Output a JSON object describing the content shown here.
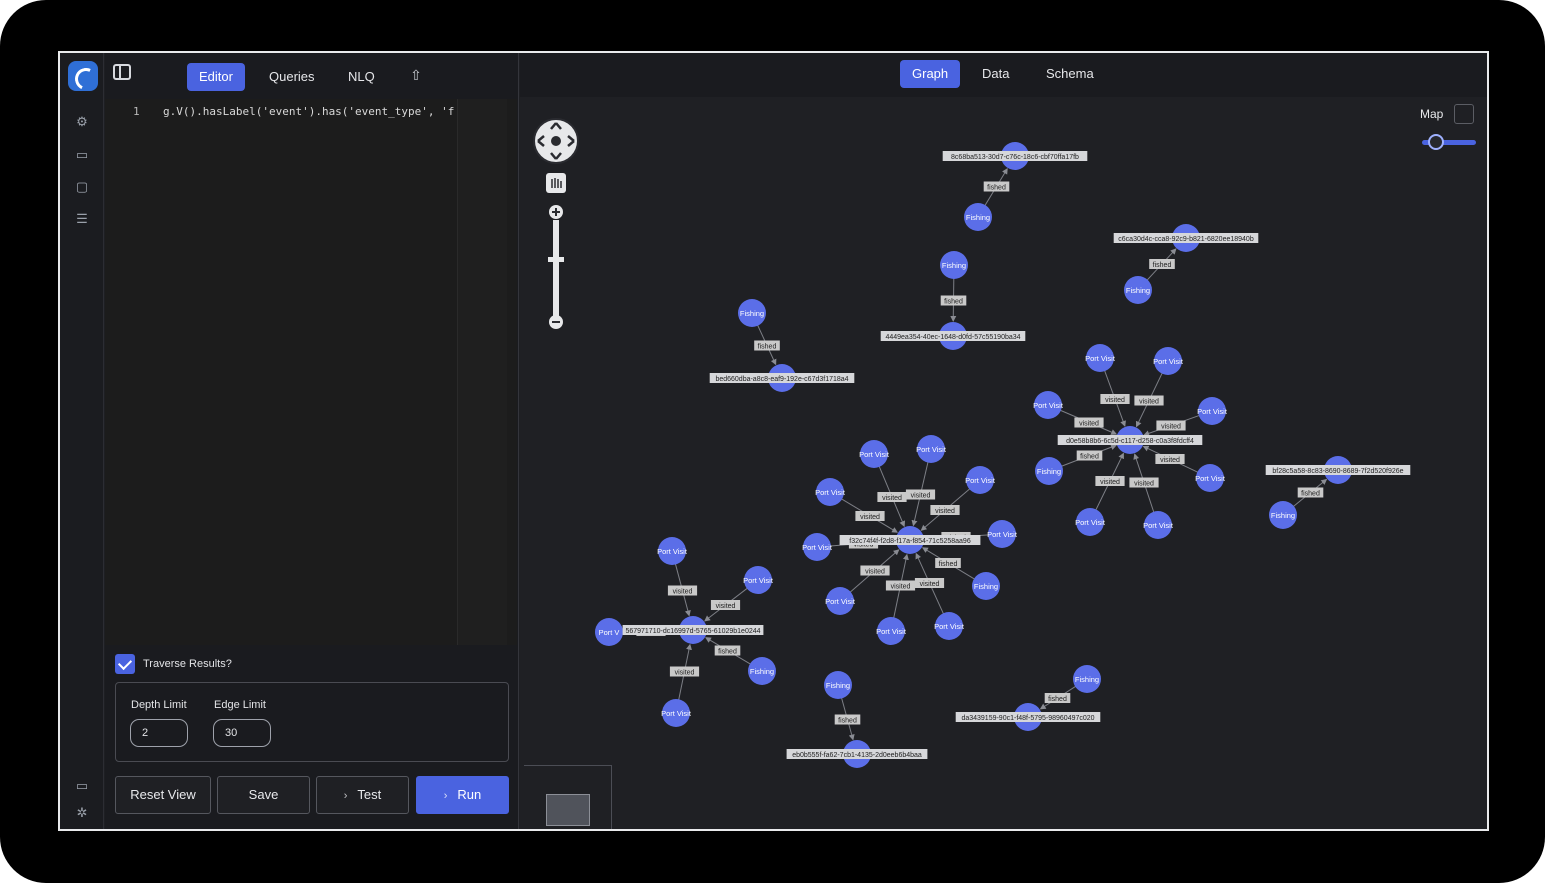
{
  "editor_tabs": {
    "editor": "Editor",
    "queries": "Queries",
    "nlq": "NLQ"
  },
  "code": {
    "line_number": "1",
    "text": "g.V().hasLabel('event').has('event_type', 'fi"
  },
  "traverse": {
    "label": "Traverse Results?",
    "checked": true
  },
  "limits": {
    "depth_label": "Depth Limit",
    "depth_value": "2",
    "edge_label": "Edge Limit",
    "edge_value": "30"
  },
  "actions": {
    "reset": "Reset View",
    "save": "Save",
    "test": "Test",
    "run": "Run"
  },
  "graph_tabs": {
    "graph": "Graph",
    "data": "Data",
    "schema": "Schema"
  },
  "map": {
    "label": "Map"
  },
  "colors": {
    "accent": "#4a63e0",
    "node": "#5b6ee8",
    "edge_label_bg": "#c9c9c9"
  },
  "graph": {
    "nodes": [
      {
        "id": "v8c6",
        "label": "8c68ba513-30d7-c76c-18c6-cbf70ffa17fb"
      },
      {
        "id": "f1",
        "label": "Fishing"
      },
      {
        "id": "c6ca",
        "label": "c6ca30d4c-cca8-92c9-b821-6820ee18940b"
      },
      {
        "id": "f2",
        "label": "Fishing"
      },
      {
        "id": "f3",
        "label": "Fishing"
      },
      {
        "id": "v444",
        "label": "4449ea354-40ec-1648-d0fd-57c55190ba34"
      },
      {
        "id": "f4",
        "label": "Fishing"
      },
      {
        "id": "vbed",
        "label": "bed660dba-a8c8-eaf9-192e-c67d3f1718a4"
      },
      {
        "id": "vd0e",
        "label": "d0e58b8b6-6c5d-c117-d258-c0a3f8fdcff4"
      },
      {
        "id": "p1",
        "label": "Port Visit"
      },
      {
        "id": "p2",
        "label": "Port Visit"
      },
      {
        "id": "p3",
        "label": "Port Visit"
      },
      {
        "id": "p4",
        "label": "Port Visit"
      },
      {
        "id": "f5",
        "label": "Fishing"
      },
      {
        "id": "p5",
        "label": "Port Visit"
      },
      {
        "id": "p6",
        "label": "Port Visit"
      },
      {
        "id": "p7",
        "label": "Port Visit"
      },
      {
        "id": "vbf2",
        "label": "bf28c5a58-8c83-8690-8689-7f2d520f926e"
      },
      {
        "id": "f6",
        "label": "Fishing"
      },
      {
        "id": "vf32",
        "label": "f32c74f4f-f2d8-f17a-f854-71c5258aa96"
      },
      {
        "id": "p8",
        "label": "Port Visit"
      },
      {
        "id": "p9",
        "label": "Port Visit"
      },
      {
        "id": "p10",
        "label": "Port Visit"
      },
      {
        "id": "p11",
        "label": "Port Visit"
      },
      {
        "id": "p12",
        "label": "Port Visit"
      },
      {
        "id": "p13",
        "label": "Port Visit"
      },
      {
        "id": "f7",
        "label": "Fishing"
      },
      {
        "id": "p14",
        "label": "Port Visit"
      },
      {
        "id": "p15",
        "label": "Port Visit"
      },
      {
        "id": "p16",
        "label": "Port Visit"
      },
      {
        "id": "v567",
        "label": "567971710-dc16997d-5765-61029b1e0244"
      },
      {
        "id": "p17",
        "label": "Port Visit"
      },
      {
        "id": "p18",
        "label": "Port Visit"
      },
      {
        "id": "pv",
        "label": "Port V"
      },
      {
        "id": "f8",
        "label": "Fishing"
      },
      {
        "id": "p19",
        "label": "Port Visit"
      },
      {
        "id": "f9",
        "label": "Fishing"
      },
      {
        "id": "veb0",
        "label": "eb0b555f-fa62-7cb1-4135-2d0eeb6b4baa"
      },
      {
        "id": "f10",
        "label": "Fishing"
      },
      {
        "id": "vda3",
        "label": "da3439159-90c1-f48f-5795-98960497c020"
      }
    ],
    "edges": [
      {
        "from": "f1",
        "to": "v8c6",
        "label": "fished"
      },
      {
        "from": "f2",
        "to": "c6ca",
        "label": "fished"
      },
      {
        "from": "f3",
        "to": "v444",
        "label": "fished"
      },
      {
        "from": "f4",
        "to": "vbed",
        "label": "fished"
      },
      {
        "from": "p1",
        "to": "vd0e",
        "label": "visited"
      },
      {
        "from": "p2",
        "to": "vd0e",
        "label": "visited"
      },
      {
        "from": "p3",
        "to": "vd0e",
        "label": "visited"
      },
      {
        "from": "p4",
        "to": "vd0e",
        "label": "visited"
      },
      {
        "from": "f5",
        "to": "vd0e",
        "label": "fished"
      },
      {
        "from": "p5",
        "to": "vd0e",
        "label": "visited"
      },
      {
        "from": "p6",
        "to": "vd0e",
        "label": "visited"
      },
      {
        "from": "p7",
        "to": "vd0e",
        "label": "visited"
      },
      {
        "from": "f6",
        "to": "vbf2",
        "label": "fished"
      },
      {
        "from": "p8",
        "to": "vf32",
        "label": "visited"
      },
      {
        "from": "p9",
        "to": "vf32",
        "label": "visited"
      },
      {
        "from": "p10",
        "to": "vf32",
        "label": "visited"
      },
      {
        "from": "p11",
        "to": "vf32",
        "label": "visited"
      },
      {
        "from": "p12",
        "to": "vf32",
        "label": "visited"
      },
      {
        "from": "p13",
        "to": "vf32",
        "label": "visited"
      },
      {
        "from": "f7",
        "to": "vf32",
        "label": "fished"
      },
      {
        "from": "p14",
        "to": "vf32",
        "label": "visited"
      },
      {
        "from": "p15",
        "to": "vf32",
        "label": "visited"
      },
      {
        "from": "p16",
        "to": "vf32",
        "label": "visited"
      },
      {
        "from": "p17",
        "to": "v567",
        "label": "visited"
      },
      {
        "from": "p18",
        "to": "v567",
        "label": "visited"
      },
      {
        "from": "pv",
        "to": "v567",
        "label": "visited"
      },
      {
        "from": "f8",
        "to": "v567",
        "label": "fished"
      },
      {
        "from": "p19",
        "to": "v567",
        "label": "visited"
      },
      {
        "from": "f9",
        "to": "veb0",
        "label": "fished"
      },
      {
        "from": "f10",
        "to": "vda3",
        "label": "fished"
      }
    ]
  }
}
